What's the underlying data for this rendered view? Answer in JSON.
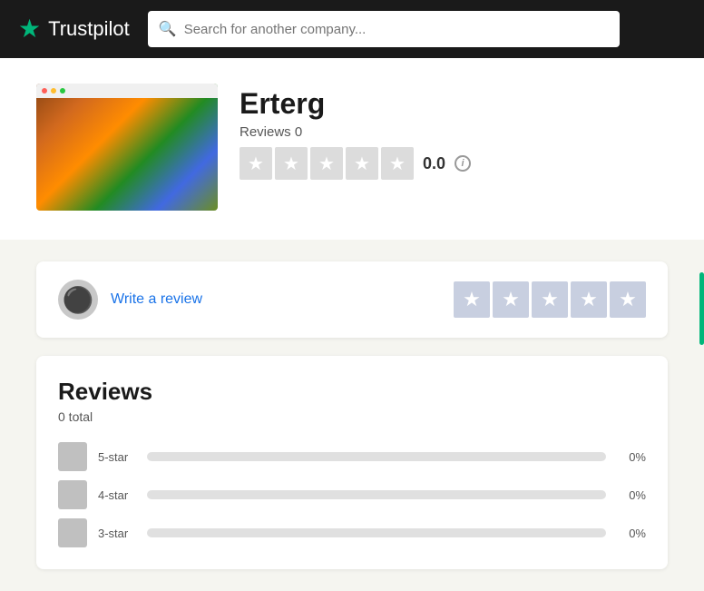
{
  "header": {
    "logo_text": "Trustpilot",
    "search_placeholder": "Search for another company..."
  },
  "company": {
    "name": "Erterg",
    "reviews_label": "Reviews 0",
    "rating_number": "0.0",
    "stars_count": 5,
    "info_icon_label": "i"
  },
  "write_review": {
    "link_text": "Write a review",
    "stars_count": 5
  },
  "reviews_section": {
    "title": "Reviews",
    "total_label": "0 total",
    "breakdown": [
      {
        "label": "5-star",
        "pct": "0%",
        "fill": 0
      },
      {
        "label": "4-star",
        "pct": "0%",
        "fill": 0
      },
      {
        "label": "3-star",
        "pct": "0%",
        "fill": 0
      }
    ]
  }
}
